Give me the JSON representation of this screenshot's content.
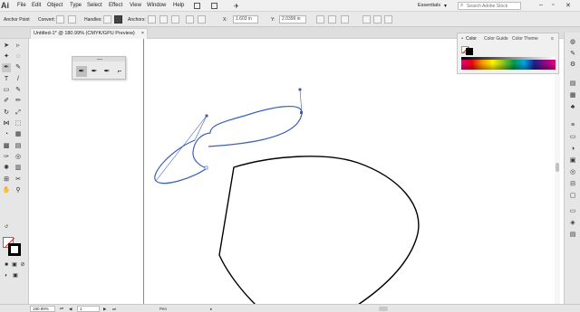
{
  "app": {
    "logo": "Ai",
    "menu": [
      "File",
      "Edit",
      "Object",
      "Type",
      "Select",
      "Effect",
      "View",
      "Window",
      "Help"
    ],
    "workspace": "Essentials",
    "search_placeholder": "Search Adobe Stock"
  },
  "control_bar": {
    "tool_label": "Anchor Point",
    "convert_label": "Convert:",
    "handles_label": "Handles:",
    "anchors_label": "Anchors:",
    "x_value": "1.603 in",
    "y_value": "2.0399 in"
  },
  "document": {
    "tab_title": "Untitled-1* @ 180.99% (CMYK/GPU Preview)",
    "close_label": "×"
  },
  "color_panel": {
    "tabs": [
      "Color",
      "Color Guide",
      "Color Theme"
    ]
  },
  "status_bar": {
    "zoom": "180.99%",
    "artboard": "1",
    "tool_name": "Pen"
  },
  "colors": {
    "selected_path": "#3a5fb7",
    "path": "#000000",
    "fill_none_slash": "#e02020"
  },
  "icons": {
    "toolbar": [
      "selection-icon",
      "direct-selection-icon",
      "magic-wand-icon",
      "lasso-icon",
      "pen-icon",
      "curvature-icon",
      "type-icon",
      "line-icon",
      "rectangle-icon",
      "paintbrush-icon",
      "shaper-icon",
      "pencil-icon",
      "rotate-icon",
      "scale-icon",
      "width-icon",
      "free-transform-icon",
      "shape-builder-icon",
      "perspective-icon",
      "mesh-icon",
      "gradient-icon",
      "eyedropper-icon",
      "blend-icon",
      "symbol-sprayer-icon",
      "graph-icon",
      "artboard-icon",
      "slice-icon",
      "hand-icon",
      "zoom-icon"
    ],
    "flyout": [
      "pen-tool-icon",
      "add-anchor-icon",
      "delete-anchor-icon",
      "anchor-point-icon"
    ],
    "dock": [
      "color-icon",
      "color-guide-icon",
      "libraries-icon",
      "properties-icon",
      "layers-icon"
    ]
  }
}
